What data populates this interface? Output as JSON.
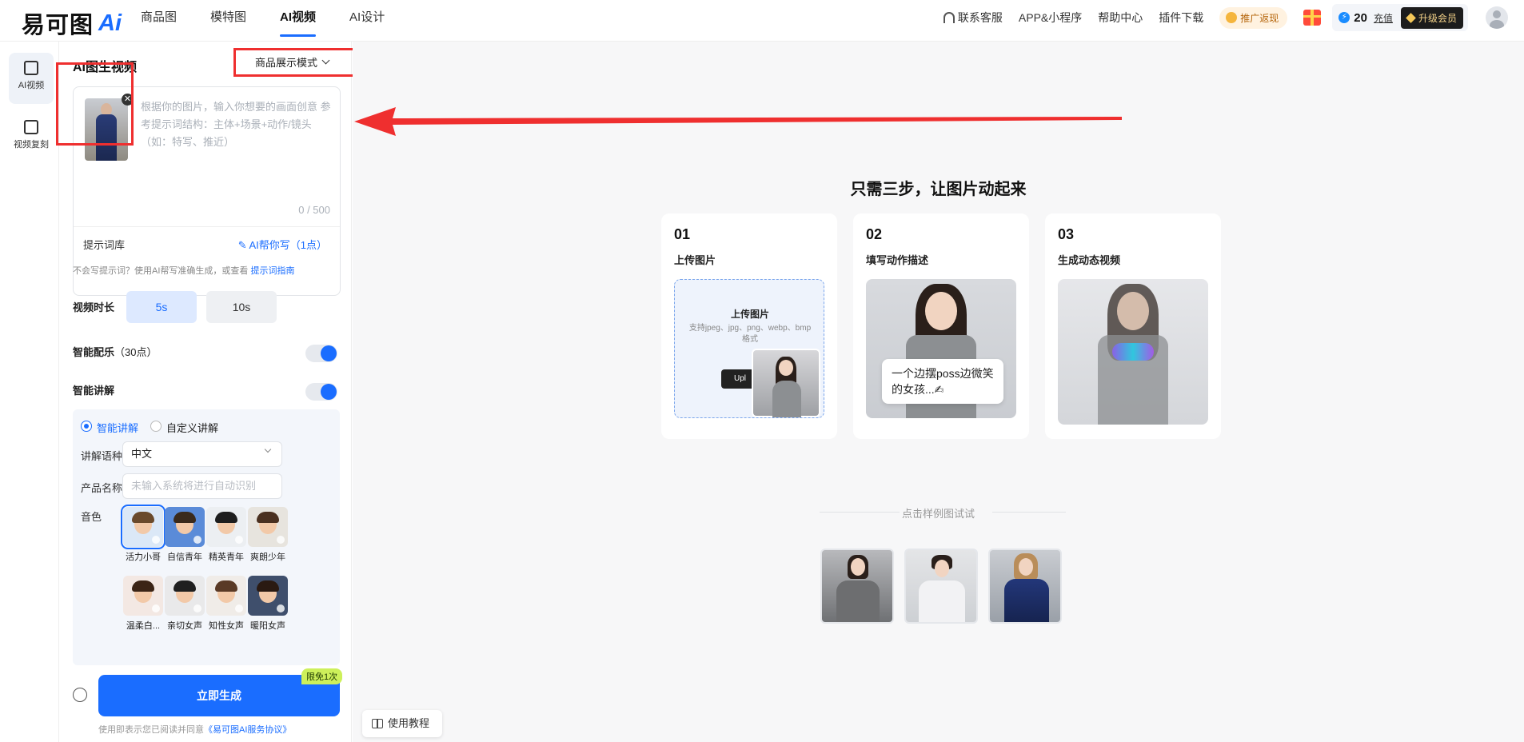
{
  "header": {
    "logo_text": "易可图",
    "logo_ai": "Ai",
    "nav": [
      "商品图",
      "模特图",
      "AI视频",
      "AI设计"
    ],
    "active_nav": "AI视频",
    "contact": "联系客服",
    "app": "APP&小程序",
    "help": "帮助中心",
    "plugin": "插件下载",
    "promo": "推广返现",
    "credits": "20",
    "recharge": "充值",
    "upgrade": "升级会员"
  },
  "rail": {
    "items": [
      "AI视频",
      "视频复刻"
    ]
  },
  "panel": {
    "title": "AI图生视频",
    "mode": "商品展示模式",
    "prompt_placeholder": "根据你的图片，输入你想要的画面创意 参考提示词结构：主体+场景+动作/镜头（如：特写、推近）",
    "counter": "0 / 500",
    "prompt_lib": "提示词库",
    "ai_write": "AI帮你写（1点）",
    "hint": "不会写提示词？使用AI帮写准确生成，或查看 ",
    "hint_link": "提示词指南",
    "duration_label": "视频时长",
    "durations": [
      "5s",
      "10s"
    ],
    "music_label": "智能配乐",
    "music_cost": "（30点）",
    "narration_label": "智能讲解",
    "narration_modes": [
      "智能讲解",
      "自定义讲解"
    ],
    "language_label": "讲解语种",
    "language_value": "中文",
    "product_label": "产品名称",
    "product_placeholder": "未输入系统将进行自动识别",
    "voice_label": "音色",
    "voices": [
      "活力小哥",
      "自信青年",
      "精英青年",
      "爽朗少年",
      "温柔白...",
      "亲切女声",
      "知性女声",
      "暖阳女声"
    ],
    "generate": "立即生成",
    "free_tag": "限免1次",
    "agree_text": "使用即表示您已阅读并同意",
    "agree_link": "《易可图AI服务协议》"
  },
  "main": {
    "title": "只需三步，让图片动起来",
    "steps": [
      {
        "num": "01",
        "title": "上传图片"
      },
      {
        "num": "02",
        "title": "填写动作描述"
      },
      {
        "num": "03",
        "title": "生成动态视频"
      }
    ],
    "upload_title": "上传图片",
    "upload_sub": "支持jpeg、jpg、png、webp、bmp格式",
    "upload_btn": "Upl",
    "bubble_text": "一个边摆poss边微笑的女孩...✍",
    "try_label": "点击样例图试试",
    "tutorial": "使用教程"
  },
  "colors": {
    "accent": "#1a6dff",
    "annotation_red": "#ef2f2f",
    "free_tag": "#cdf05a"
  }
}
